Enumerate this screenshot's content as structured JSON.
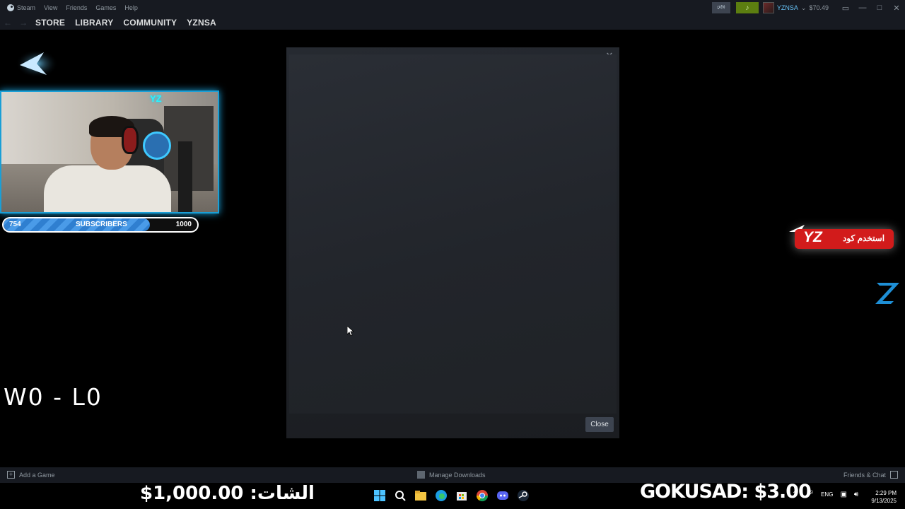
{
  "menu": {
    "steam": "Steam",
    "view": "View",
    "friends": "Friends",
    "games": "Games",
    "help": "Help"
  },
  "account": {
    "name": "YZNSA",
    "balance": "$70.49"
  },
  "nav": {
    "tabs": [
      "STORE",
      "LIBRARY",
      "COMMUNITY",
      "YZNSA"
    ]
  },
  "overlay": {
    "subscribers": {
      "current": "754",
      "label": "SUBSCRIBERS",
      "goal": "1000",
      "progress_percent": 75.4
    },
    "score": "W0 - L0",
    "code_badge": {
      "brand": "YZ",
      "text": "استخدم كود"
    },
    "webcam_brand": "YZ"
  },
  "modal": {
    "close_label": "Close"
  },
  "bottom_bar": {
    "add_game": "Add a Game",
    "manage_downloads": "Manage Downloads",
    "friends_chat": "Friends & Chat"
  },
  "ticker": {
    "left": "الشات: 1,000.00$",
    "right": "GOKUSAD: $3.00"
  },
  "tray": {
    "language": "ENG"
  },
  "clock": {
    "time": "2:29 PM",
    "date": "9/13/2025"
  },
  "colors": {
    "steam_bg": "#171a21",
    "accent_blue": "#1a9fd6",
    "notif_green": "#5c7e10",
    "code_red": "#d21b1b"
  }
}
